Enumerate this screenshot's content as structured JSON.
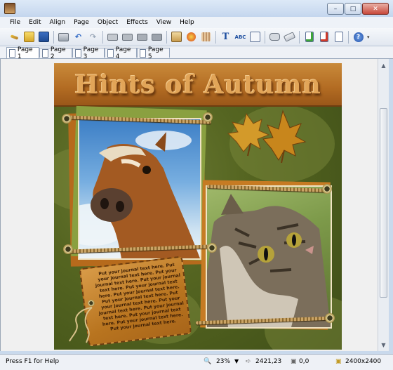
{
  "window": {
    "title": ""
  },
  "menu": [
    "File",
    "Edit",
    "Align",
    "Page",
    "Object",
    "Effects",
    "View",
    "Help"
  ],
  "toolbar": {
    "buttons": [
      "wizard-icon",
      "open-icon",
      "save-icon",
      "print-icon",
      "undo-icon",
      "redo-icon",
      "bring-to-front-icon",
      "bring-forward-icon",
      "send-backward-icon",
      "send-to-back-icon",
      "insert-image-icon",
      "insert-clipart-icon",
      "insert-texture-icon",
      "text-icon",
      "spell-check-icon",
      "notes-icon",
      "speech-bubble-icon",
      "eraser-icon",
      "new-page-icon",
      "delete-page-icon",
      "page-settings-icon",
      "help-icon"
    ]
  },
  "tabs": [
    "Page 1",
    "Page 2",
    "Page 3",
    "Page 4",
    "Page 5"
  ],
  "active_tab": "Page 1",
  "page": {
    "title": "Hints of Autumn",
    "journal_text": "Put your journal text here. Put your journal text here. Put your journal text here. Put your journal text here. Put your journal text here. Put your journal text here. Put your journal text here. Put your journal text here. Put your journal text here. Put your journal text here. Put your journal text here. Put your journal text here. Put your journal text here."
  },
  "status": {
    "help": "Press F1 for Help",
    "zoom": "23%",
    "cursor": "2421,23",
    "offset": "0,0",
    "size": "2400x2400"
  },
  "colors": {
    "banner": "#b26b22",
    "background": "#556521",
    "tag": "#c98a3a"
  }
}
